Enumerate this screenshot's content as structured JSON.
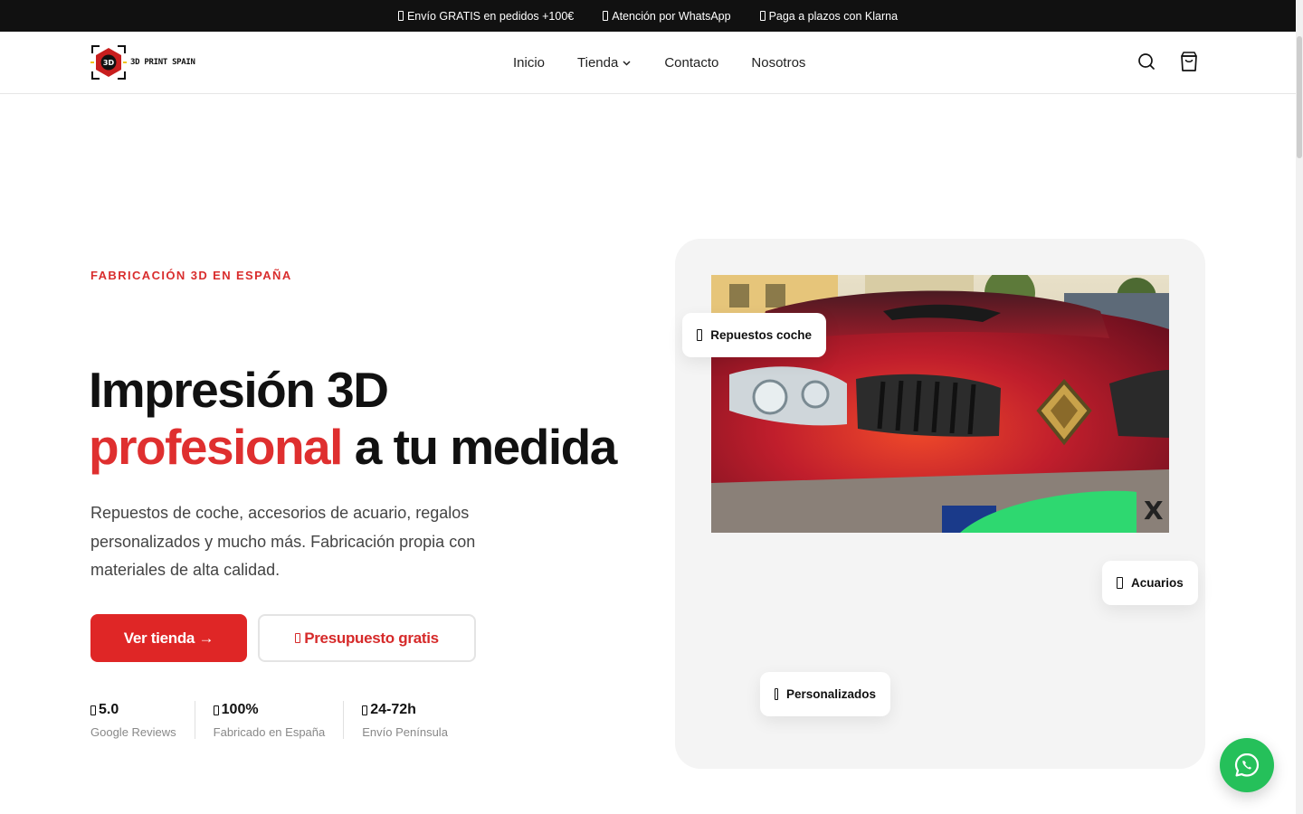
{
  "topbar": {
    "messages": [
      {
        "text": "Envío GRATIS en pedidos +100€"
      },
      {
        "text": "Atención por WhatsApp"
      },
      {
        "text": "Paga a plazos con Klarna"
      }
    ]
  },
  "header": {
    "logo_text": "3D PRINT SPAIN",
    "logo_mark": "3D",
    "nav": [
      {
        "label": "Inicio"
      },
      {
        "label": "Tienda"
      },
      {
        "label": "Contacto"
      },
      {
        "label": "Nosotros"
      }
    ],
    "icons": [
      "search-icon",
      "cart-icon"
    ]
  },
  "hero": {
    "eyebrow": "FABRICACIÓN 3D EN ESPAÑA",
    "headline_line1": "Impresión 3D",
    "headline_accent": "profesional",
    "headline_rest": " a tu medida",
    "description": "Repuestos de coche, accesorios de acuario, regalos personalizados y mucho más. Fabricación propia con materiales de alta calidad.",
    "primary_button": "Ver tienda →",
    "secondary_button": "Presupuesto gratis",
    "stats": [
      {
        "value": "5.0",
        "label": "Google Reviews"
      },
      {
        "value": "100%",
        "label": "Fabricado en España"
      },
      {
        "value": "24-72h",
        "label": "Envío Península"
      }
    ],
    "chips": [
      {
        "label": "Repuestos coche"
      },
      {
        "label": "Acuarios"
      },
      {
        "label": "Personalizados"
      }
    ]
  },
  "colors": {
    "accent": "#df2626",
    "topbar_bg": "#111111",
    "card_bg": "#f4f4f4",
    "whatsapp": "#25c05a"
  }
}
